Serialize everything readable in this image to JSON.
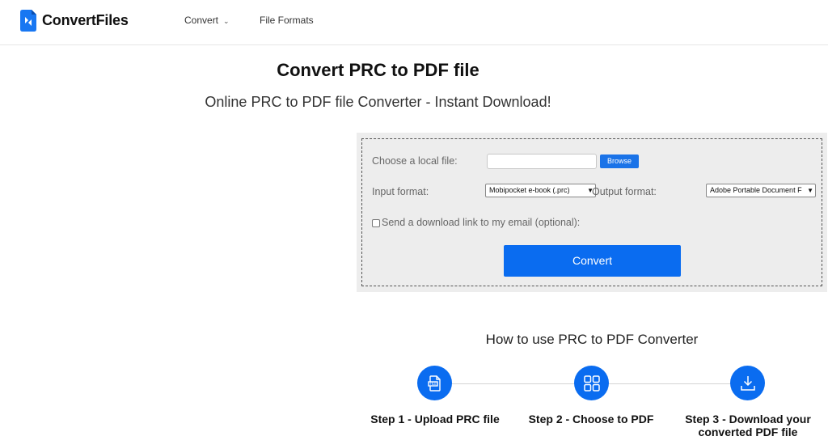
{
  "header": {
    "brand": "ConvertFiles",
    "nav": {
      "convert": "Convert",
      "formats": "File Formats"
    }
  },
  "main": {
    "title": "Convert PRC to PDF file",
    "subtitle": "Online PRC to PDF file Converter - Instant Download!"
  },
  "form": {
    "choose_label": "Choose a local file:",
    "browse": "Browse",
    "input_format_label": "Input format:",
    "input_format_value": "Mobipocket e-book (.prc)",
    "output_format_label": "Output format:",
    "output_format_value": "Adobe Portable Document F",
    "email_label": "Send a download link to my email (optional):",
    "convert": "Convert"
  },
  "howto": {
    "title": "How to use PRC to PDF Converter",
    "steps": [
      {
        "label": "Step 1 - Upload PRC file",
        "icon": "file-upload-icon"
      },
      {
        "label": "Step 2 - Choose to PDF",
        "icon": "grid-icon"
      },
      {
        "label": "Step 3 - Download your converted PDF file",
        "icon": "download-icon"
      }
    ]
  },
  "colors": {
    "accent": "#0a6cf0",
    "panel": "#ededed"
  }
}
